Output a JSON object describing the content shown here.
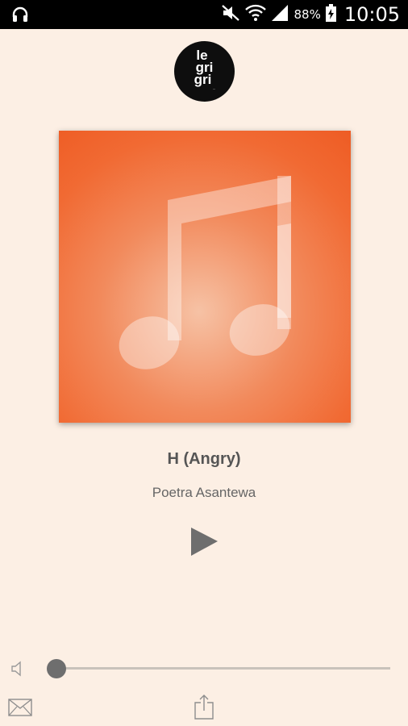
{
  "status_bar": {
    "battery_percent": "88%",
    "time": "10:05",
    "icons": [
      "headphones-icon",
      "mute-icon",
      "wifi-icon",
      "signal-icon",
      "battery-icon"
    ]
  },
  "logo": {
    "line1": "le",
    "line2": "gri",
    "line3": "gri",
    "tagline": "..."
  },
  "artwork": {
    "icon": "music-note-icon",
    "colors": [
      "#ee5c24",
      "#f6c2a5"
    ]
  },
  "track": {
    "title": "H (Angry)",
    "artist": "Poetra Asantewa"
  },
  "controls": {
    "play_icon": "play-icon",
    "volume_icon": "speaker-icon",
    "volume_level": 0
  },
  "bottom_bar": {
    "mail_icon": "mail-icon",
    "share_icon": "share-icon"
  }
}
